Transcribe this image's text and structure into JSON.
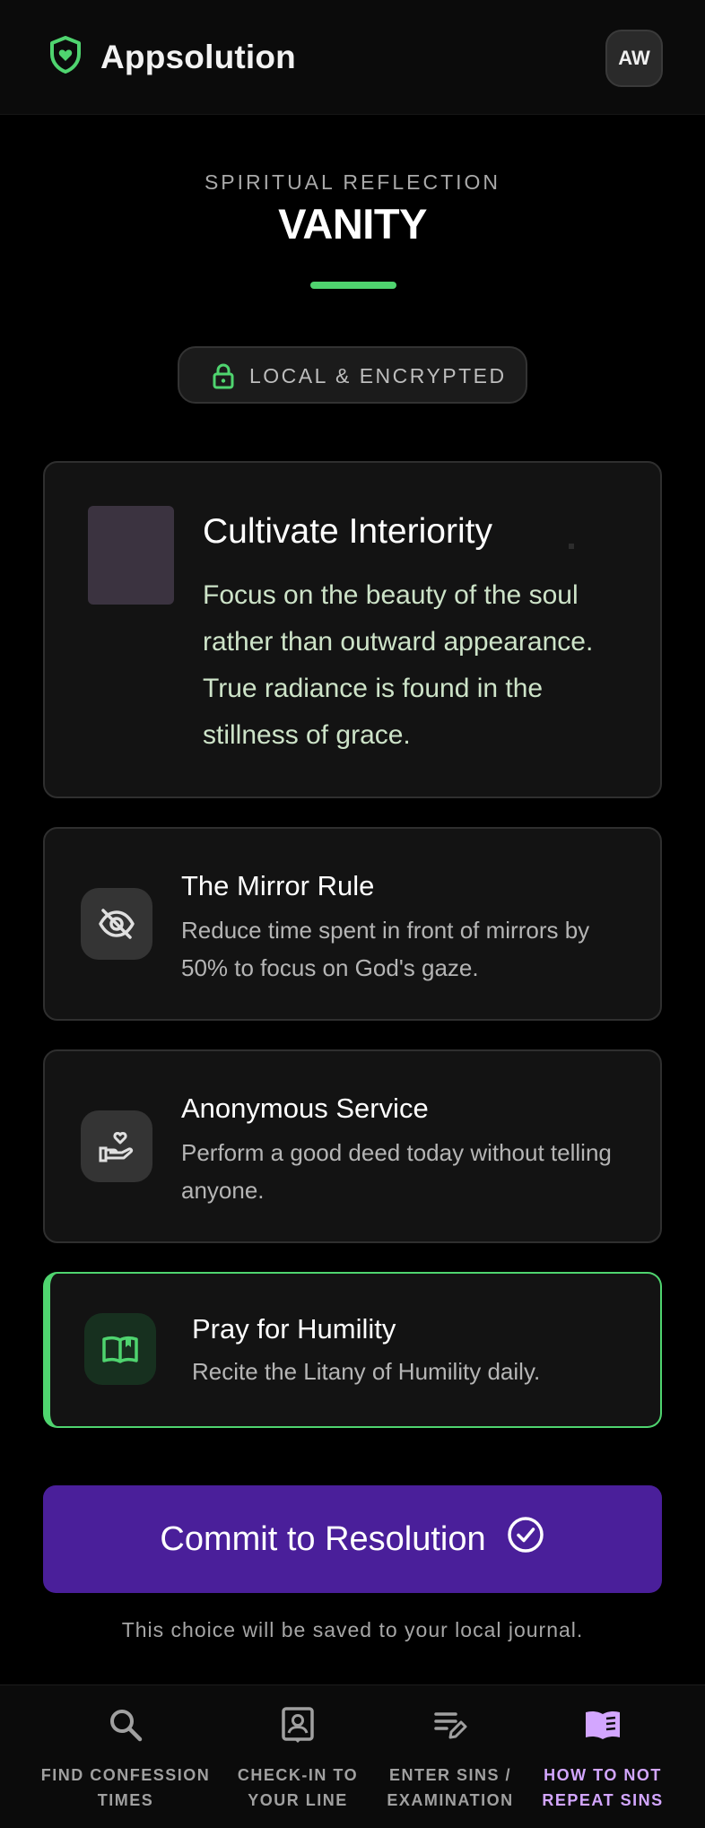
{
  "header": {
    "app_title": "Appsolution",
    "avatar_initials": "AW",
    "logo_icon": "shield-heart-icon"
  },
  "hero": {
    "kicker": "SPIRITUAL REFLECTION",
    "title": "VANITY",
    "privacy_label": "LOCAL & ENCRYPTED"
  },
  "featured": {
    "title": "Cultivate Interiority",
    "description": "Focus on the beauty of the soul rather than outward appearance. True radiance is found in the stillness of grace."
  },
  "tips": [
    {
      "title": "The Mirror Rule",
      "description": "Reduce time spent in front of mirrors by 50% to focus on God's gaze.",
      "icon": "eye-off-icon"
    },
    {
      "title": "Anonymous Service",
      "description": "Perform a good deed today without telling anyone.",
      "icon": "hand-heart-icon"
    },
    {
      "title": "Pray for Humility",
      "description": "Recite the Litany of Humility daily.",
      "icon": "open-book-icon",
      "selected": true
    }
  ],
  "commit": {
    "label": "Commit to Resolution",
    "note": "This choice will be saved to your local journal."
  },
  "nav": [
    {
      "label": "FIND CONFESSION TIMES",
      "icon": "search-icon"
    },
    {
      "label": "CHECK-IN TO YOUR LINE",
      "icon": "person-badge-icon"
    },
    {
      "label": "ENTER SINS / EXAMINATION",
      "icon": "edit-list-icon"
    },
    {
      "label": "HOW TO NOT REPEAT SINS",
      "icon": "book-icon",
      "active": true
    }
  ],
  "colors": {
    "accent_green": "#4fd46f",
    "commit_purple": "#4a1f9a",
    "active_nav": "#d3a6ff"
  }
}
